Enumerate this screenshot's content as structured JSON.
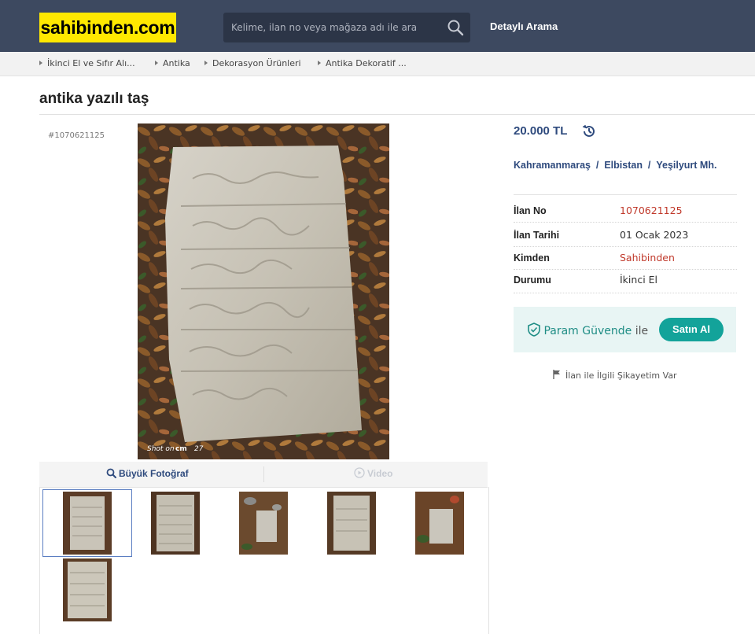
{
  "header": {
    "logo_text": "sahibinden.com",
    "search_placeholder": "Kelime, ilan no veya mağaza adı ile ara",
    "detailed_search": "Detaylı Arama",
    "colors": {
      "header_bg": "#3d4960",
      "logo_bg": "#ffe800",
      "accent": "#2e4a7d",
      "secure": "#13a39a"
    }
  },
  "breadcrumb": [
    "İkinci El ve Sıfır Alı...",
    "Antika",
    "Dekorasyon Ürünleri",
    "Antika Dekoratif ..."
  ],
  "listing": {
    "title": "antika yazılı taş",
    "id_label": "#1070621125",
    "price": "20.000 TL",
    "location": {
      "city": "Kahramanmaraş",
      "district": "Elbistan",
      "neighborhood": "Yeşilyurt Mh."
    },
    "info": [
      {
        "key": "İlan No",
        "value": "1070621125"
      },
      {
        "key": "İlan Tarihi",
        "value": "01 Ocak 2023"
      },
      {
        "key": "Kimden",
        "value": "Sahibinden"
      },
      {
        "key": "Durumu",
        "value": "İkinci El"
      }
    ],
    "secure": {
      "brand": "Param Güvende",
      "ile": "ile",
      "buy_label": "Satın Al"
    },
    "complaint": "İlan ile İlgili Şikayetim Var"
  },
  "photo": {
    "watermark": "Shot on",
    "watermark_brand": "27",
    "tab_big": "Büyük Fotoğraf",
    "tab_video": "Video",
    "thumb_count": 6
  }
}
